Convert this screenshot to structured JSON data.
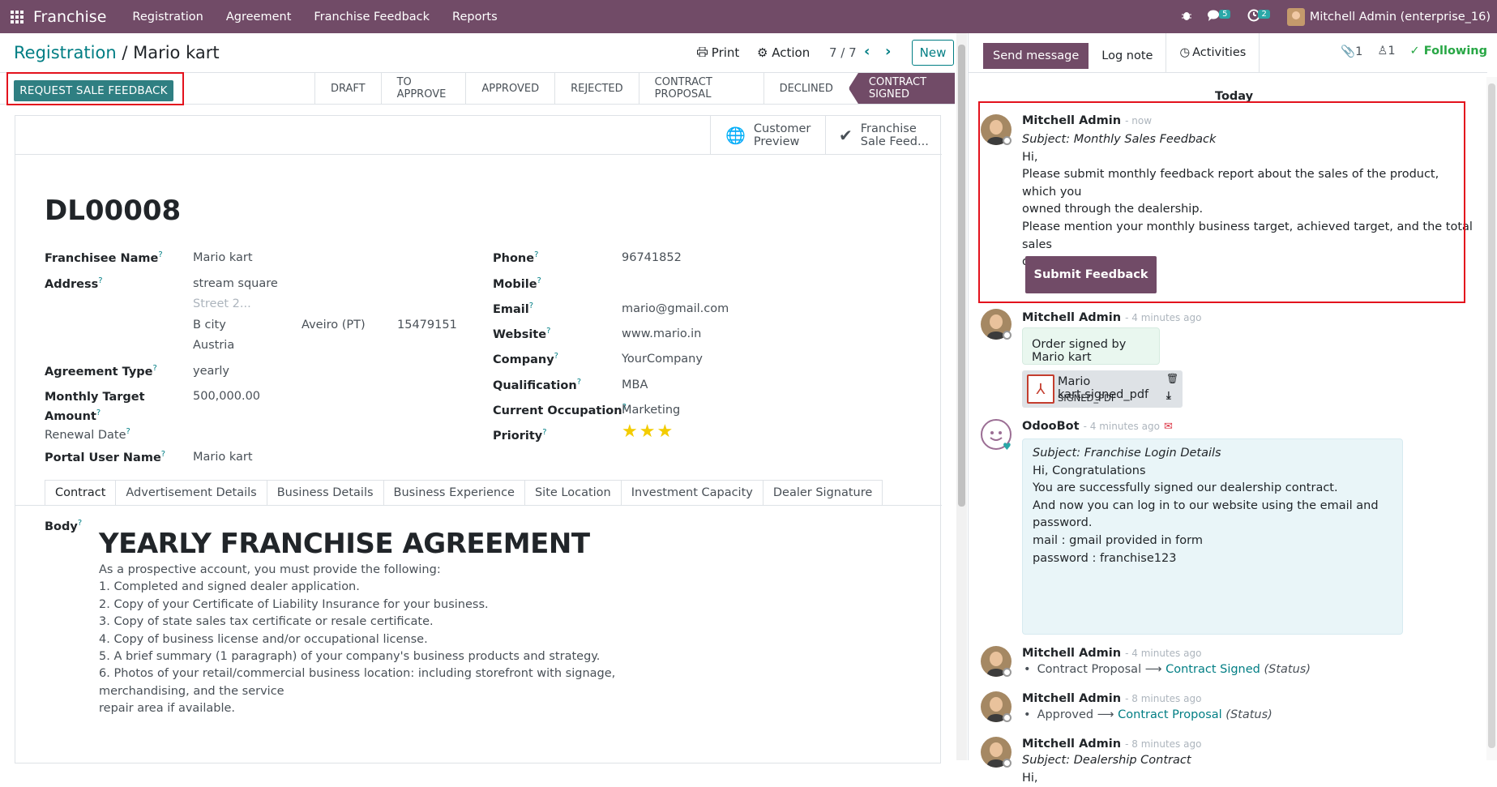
{
  "topbar": {
    "app_name": "Franchise",
    "menu": [
      "Registration",
      "Agreement",
      "Franchise Feedback",
      "Reports"
    ],
    "messages_count": "5",
    "activities_count": "2",
    "user": "Mitchell Admin (enterprise_16)"
  },
  "breadcrumb": {
    "parent": "Registration",
    "separator": "/",
    "current": "Mario kart"
  },
  "controls": {
    "print": "Print",
    "action": "Action",
    "pager": "7 / 7",
    "new": "New"
  },
  "statusbar": {
    "request_button": "REQUEST SALE FEEDBACK",
    "stages": [
      "DRAFT",
      "TO APPROVE",
      "APPROVED",
      "REJECTED",
      "CONTRACT PROPOSAL",
      "DECLINED",
      "CONTRACT SIGNED"
    ],
    "active_stage": "CONTRACT SIGNED"
  },
  "smart_buttons": {
    "preview_l1": "Customer",
    "preview_l2": "Preview",
    "feedback_l1": "Franchise",
    "feedback_l2": "Sale Feed..."
  },
  "record": {
    "name": "DL00008",
    "franchisee_label": "Franchisee Name",
    "franchisee": "Mario kart",
    "address_label": "Address",
    "street": "stream square",
    "street2_placeholder": "Street 2...",
    "city": "B city",
    "state": "Aveiro (PT)",
    "zip": "15479151",
    "country": "Austria",
    "agreement_type_label": "Agreement Type",
    "agreement_type": "yearly",
    "monthly_target_label_1": "Monthly Target",
    "monthly_target_label_2": "Amount",
    "monthly_target": "500,000.00",
    "renewal_label": "Renewal Date",
    "portal_user_label": "Portal User Name",
    "portal_user": "Mario kart",
    "phone_label": "Phone",
    "phone": "96741852",
    "mobile_label": "Mobile",
    "email_label": "Email",
    "email": "mario@gmail.com",
    "website_label": "Website",
    "website": "www.mario.in",
    "company_label": "Company",
    "company": "YourCompany",
    "qualification_label": "Qualification",
    "qualification": "MBA",
    "occupation_label": "Current Occupation",
    "occupation": "Marketing",
    "priority_label": "Priority",
    "priority_stars": 3
  },
  "tabs": [
    "Contract",
    "Advertisement Details",
    "Business Details",
    "Business Experience",
    "Site Location",
    "Investment Capacity",
    "Dealer Signature"
  ],
  "contract": {
    "body_label": "Body",
    "title": "YEARLY FRANCHISE AGREEMENT",
    "lines": [
      "As a prospective account, you must provide the following:",
      "1. Completed and signed dealer application.",
      "2. Copy of your Certificate of Liability Insurance for your business.",
      "3. Copy of state sales tax certificate or resale certificate.",
      "4. Copy of business license and/or occupational license.",
      "5. A brief summary (1 paragraph) of your company's business products and strategy.",
      "6. Photos of your retail/commercial business location: including storefront with signage, merchandising, and the service",
      "repair area if available."
    ]
  },
  "chatter": {
    "send_message": "Send message",
    "log_note": "Log note",
    "activities": "Activities",
    "attachments": "1",
    "followers": "1",
    "following": "Following",
    "today": "Today",
    "m1": {
      "author": "Mitchell Admin",
      "when": "- now",
      "subject": "Subject: Monthly Sales Feedback",
      "hi": "Hi,",
      "p1a": "Please submit monthly feedback report about the sales of the product, which you",
      "p1b": "owned through the dealership.",
      "p2a": "Please mention your monthly business target, achieved target, and the total sales",
      "p2b": "done .",
      "button": "Submit Feedback"
    },
    "m2": {
      "author": "Mitchell Admin",
      "when": "- 4 minutes ago",
      "text": "Order signed by Mario kart",
      "file": "Mario kart.signed_pdf",
      "file_type": "SIGNED_PDF"
    },
    "m3": {
      "author": "OdooBot",
      "when": "- 4 minutes ago",
      "subject": "Subject: Franchise Login Details",
      "l1": "Hi, Congratulations",
      "l2": "You are successfully signed our dealership contract.",
      "l3": "And now you can log in to our website using the email and password.",
      "l4": "mail : gmail provided in form",
      "l5": "password : franchise123"
    },
    "m4": {
      "author": "Mitchell Admin",
      "when": "- 4 minutes ago",
      "from": "Contract Proposal",
      "to": "Contract Signed",
      "field": "(Status)"
    },
    "m5": {
      "author": "Mitchell Admin",
      "when": "- 8 minutes ago",
      "from": "Approved",
      "to": "Contract Proposal",
      "field": "(Status)"
    },
    "m6": {
      "author": "Mitchell Admin",
      "when": "- 8 minutes ago",
      "subject": "Subject: Dealership Contract",
      "hi": "Hi,"
    }
  },
  "colors": {
    "brand": "#714B67",
    "teal": "#017e84",
    "highlight_box": "#e3121d",
    "star": "#f3cc00"
  }
}
